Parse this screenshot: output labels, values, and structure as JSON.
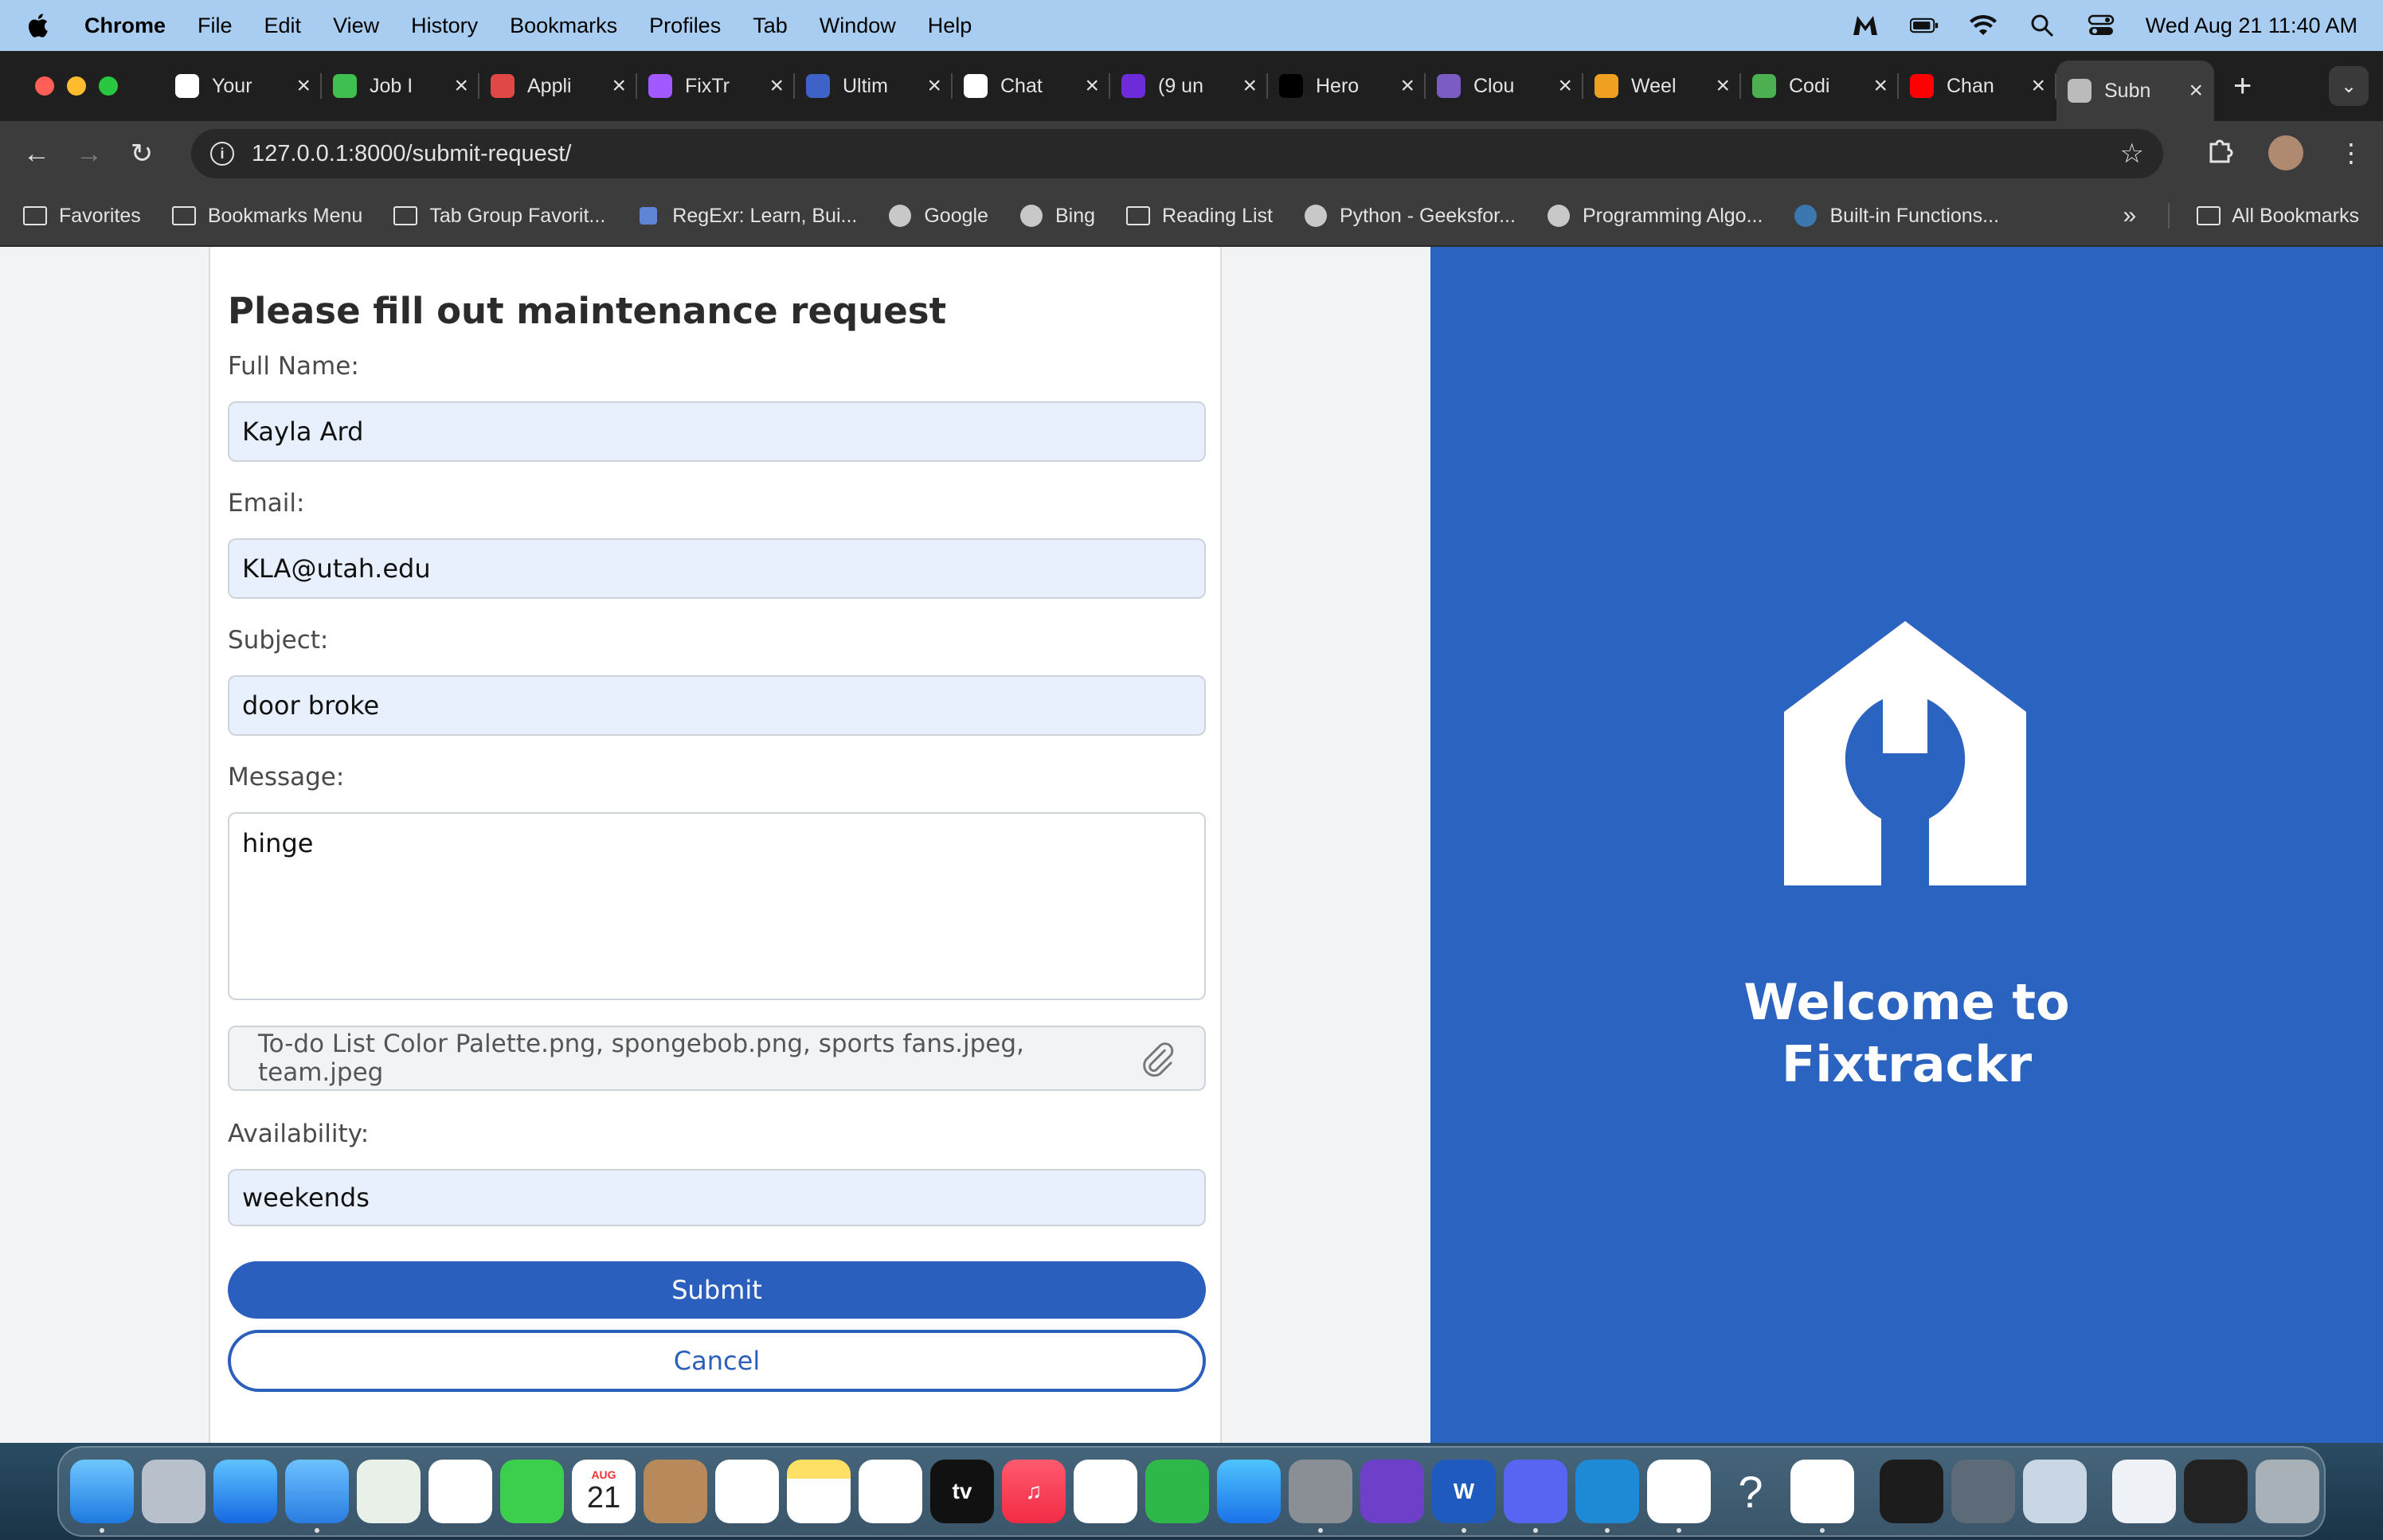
{
  "menubar": {
    "app": "Chrome",
    "items": [
      "File",
      "Edit",
      "View",
      "History",
      "Bookmarks",
      "Profiles",
      "Tab",
      "Window",
      "Help"
    ],
    "clock": "Wed Aug 21  11:40 AM"
  },
  "tabs": [
    {
      "label": "Your",
      "favicon": "github-icon",
      "color": "#ffffff"
    },
    {
      "label": "Job I",
      "favicon": "job-icon",
      "color": "#3fbf4f"
    },
    {
      "label": "Appli",
      "favicon": "greenhouse-icon",
      "color": "#e04848"
    },
    {
      "label": "FixTr",
      "favicon": "figma-icon",
      "color": "#a259ff"
    },
    {
      "label": "Ultim",
      "favicon": "fx-icon",
      "color": "#3f62c8"
    },
    {
      "label": "Chat",
      "favicon": "chatgpt-icon",
      "color": "#ffffff"
    },
    {
      "label": "(9 un",
      "favicon": "mail-icon",
      "color": "#6d2bd9"
    },
    {
      "label": "Hero",
      "favicon": "medium-icon",
      "color": "#000000"
    },
    {
      "label": "Clou",
      "favicon": "cloud-icon",
      "color": "#7b5cc4"
    },
    {
      "label": "Weel",
      "favicon": "weekly-icon",
      "color": "#f0a020"
    },
    {
      "label": "Codi",
      "favicon": "coding-icon",
      "color": "#4caf50"
    },
    {
      "label": "Chan",
      "favicon": "youtube-icon",
      "color": "#ff0000"
    },
    {
      "label": "Subn",
      "favicon": "globe-icon",
      "color": "#bbbbbb",
      "active": true
    }
  ],
  "address": {
    "url": "127.0.0.1:8000/submit-request/"
  },
  "bookmarks": [
    {
      "label": "Favorites",
      "icon": "folder-icon"
    },
    {
      "label": "Bookmarks Menu",
      "icon": "folder-icon"
    },
    {
      "label": "Tab Group Favorit...",
      "icon": "folder-icon"
    },
    {
      "label": "RegExr: Learn, Bui...",
      "icon": "regexr-icon"
    },
    {
      "label": "Google",
      "icon": "globe-icon"
    },
    {
      "label": "Bing",
      "icon": "globe-icon"
    },
    {
      "label": "Reading List",
      "icon": "folder-icon"
    },
    {
      "label": "Python - Geeksfor...",
      "icon": "globe-icon"
    },
    {
      "label": "Programming Algo...",
      "icon": "globe-icon"
    },
    {
      "label": "Built-in Functions...",
      "icon": "python-icon"
    }
  ],
  "bookmarks_more": "»",
  "all_bookmarks": "All Bookmarks",
  "form": {
    "title": "Please fill out maintenance request",
    "full_name_label": "Full Name:",
    "full_name_value": "Kayla Ard",
    "email_label": "Email:",
    "email_value": "KLA@utah.edu",
    "subject_label": "Subject:",
    "subject_value": "door broke",
    "message_label": "Message:",
    "message_value": "hinge",
    "attachments": "To-do List Color Palette.png, spongebob.png, sports fans.jpeg, team.jpeg",
    "availability_label": "Availability:",
    "availability_value": "weekends",
    "submit_label": "Submit",
    "cancel_label": "Cancel"
  },
  "hero": {
    "title_line1": "Welcome to",
    "title_line2": "Fixtrackr",
    "background": "#2b63c0"
  },
  "dock": {
    "calendar_month": "AUG",
    "calendar_day": "21",
    "appletv": "tv",
    "help": "?"
  }
}
